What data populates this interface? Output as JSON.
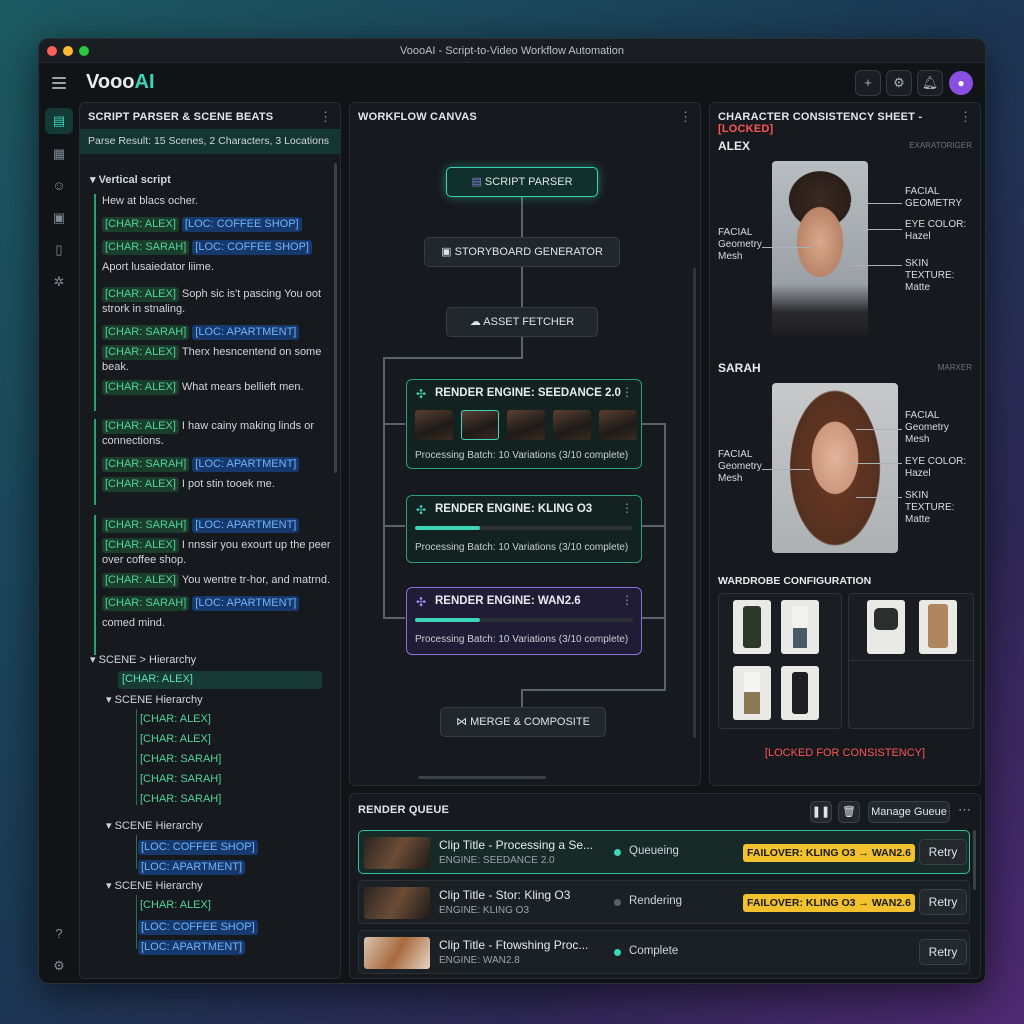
{
  "window": {
    "title": "VoooAI - Script-to-Video Workflow Automation"
  },
  "app": {
    "logo_prefix": "Vooo",
    "logo_suffix": "AI"
  },
  "script_panel": {
    "title": "SCRIPT PARSER & SCENE BEATS",
    "parse_result": "Parse Result: 15 Scenes, 2 Characters, 3 Locations",
    "section": "Vertical script",
    "intro_line": "Hew at blacs ocher.",
    "g1": {
      "l1": [
        "[CHAR: ALEX]",
        "[LOC: COFFEE SHOP]"
      ],
      "l2": [
        "[CHAR: SARAH]",
        "[LOC: COFFEE SHOP]"
      ]
    },
    "plain_line": "Aport lusaiedator liime.",
    "g2": {
      "l1_chip": "[CHAR: ALEX]",
      "l1_text": "Soph sic is't pascing You oot strork in stnaling.",
      "l2": [
        "[CHAR: SARAH]",
        "[LOC: APARTMENT]"
      ],
      "l3_chip": "[CHAR: ALEX]",
      "l3_text": "Therx hesncentend on some beak.",
      "l4_chip": "[CHAR: ALEX]",
      "l4_text": "What mears bellieft men."
    },
    "g3": {
      "l1_chip": "[CHAR: ALEX]",
      "l1_text": "I haw cainy making linds or connections.",
      "l2": [
        "[CHAR: SARAH]",
        "[LOC: APARTMENT]"
      ],
      "l3_chip": "[CHAR: ALEX]",
      "l3_text": "I pot stin tooek me."
    },
    "g4": {
      "l1": [
        "[CHAR: SARAH]",
        "[LOC: APARTMENT]"
      ],
      "l2_chip": "[CHAR: ALEX]",
      "l2_text": "I nnssir you exourt up the peer over coffee shop.",
      "l3_chip": "[CHAR: ALEX]",
      "l3_text": "You wentre tr-hor, and matrnd.",
      "l4": [
        "[CHAR: SARAH]",
        "[LOC: APARTMENT]"
      ],
      "l5_text": "comed mind."
    },
    "hierarchy": {
      "root": "SCENE > Hierarchy",
      "root_child": "[CHAR: ALEX]",
      "s1": {
        "label": "SCENE Hierarchy",
        "items": [
          "[CHAR: ALEX]",
          "[CHAR: ALEX]",
          "[CHAR: SARAH]",
          "[CHAR: SARAH]",
          "[CHAR: SARAH]"
        ]
      },
      "s2": {
        "label": "SCENE Hierarchy",
        "items": [
          "[LOC: COFFEE SHOP]",
          "[LOC: APARTMENT]"
        ]
      },
      "s3": {
        "label": "SCENE Hierarchy",
        "items": [
          "[CHAR: ALEX]",
          "[LOC: COFFEE SHOP]",
          "[LOC: APARTMENT]"
        ]
      }
    }
  },
  "canvas": {
    "title": "WORKFLOW CANVAS",
    "nodes": {
      "parser": "SCRIPT PARSER",
      "storyboard": "STORYBOARD GENERATOR",
      "fetcher": "ASSET FETCHER",
      "merge": "MERGE & COMPOSITE"
    },
    "engines": [
      {
        "title": "RENDER ENGINE: SEEDANCE 2.0",
        "status": "Processing Batch: 10 Variations (3/10 complete)"
      },
      {
        "title": "RENDER ENGINE: KLING O3",
        "status": "Processing Batch: 10 Variations (3/10 complete)",
        "progress": 0.3
      },
      {
        "title": "RENDER ENGINE: WAN2.6",
        "status": "Processing Batch: 10 Variations (3/10 complete)",
        "progress": 0.3
      }
    ]
  },
  "character_sheet": {
    "title": "CHARACTER CONSISTENCY SHEET - ",
    "locked": "[LOCKED]",
    "alex": {
      "name": "ALEX",
      "tag": "EXARATORIGER",
      "facial_geometry": "FACIAL GEOMETRY",
      "mesh": "FACIAL Geometry Mesh",
      "eye_label": "EYE COLOR:",
      "eye_value": "Hazel",
      "skin_label": "SKIN TEXTURE:",
      "skin_value": "Matte"
    },
    "sarah": {
      "name": "SARAH",
      "tag": "MARXER",
      "facial_geometry": "FACIAL Geometry Mesh",
      "mesh": "FACIAL Geometry Mesh",
      "eye_label": "EYE COLOR:",
      "eye_value": "Hazel",
      "skin_label": "SKIN TEXTURE:",
      "skin_value": "Matte"
    },
    "wardrobe_title": "WARDROBE CONFIGURATION",
    "locked_note": "[LOCKED FOR CONSISTENCY]"
  },
  "queue": {
    "title": "RENDER QUEUE",
    "manage": "Manage Gueue",
    "rows": [
      {
        "title": "Clip Title - Processing a Se...",
        "engine": "ENGINE: SEEDANCE 2.0",
        "status": "Queueing",
        "failover": "FAILOVER: KLING O3 → WAN2.6",
        "retry": "Retry"
      },
      {
        "title": "Clip Title - Stor: Kling O3",
        "engine": "ENGINE: KLING O3",
        "status": "Rendering",
        "failover": "FAILOVER: KLING O3 → WAN2.6",
        "retry": "Retry"
      },
      {
        "title": "Clip Title - Ftowshing Proc...",
        "engine": "ENGINE: WAN2.8",
        "status": "Complete",
        "retry": "Retry"
      }
    ]
  },
  "colors": {
    "accent": "#3dd4b7",
    "locked": "#ff5555",
    "failover": "#f2c12e"
  }
}
